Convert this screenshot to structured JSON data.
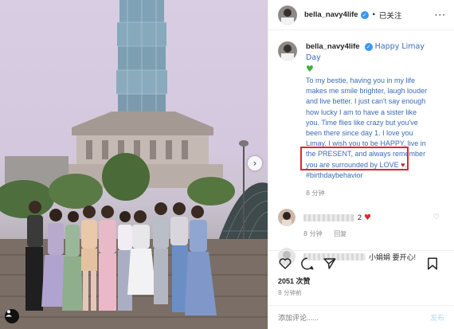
{
  "header": {
    "username": "bella_navy4life",
    "follow_status": "已关注",
    "separator": "•",
    "more_label": "···"
  },
  "caption": {
    "username": "bella_navy4life",
    "title": "Happy Limay Day",
    "lines": [
      "To my bestie, having you in my life",
      "makes me smile brighter, laugh louder",
      "and live better. I just can't say enough",
      "how lucky I am to have a sister like",
      "you. Time flies like crazy but you've",
      "been there since day 1. I love you",
      "Limay. I wish you to be HAPPY, live in",
      "the PRESENT, and always remember",
      "you are surrounded by LOVE",
      "#birthdaybehavior"
    ],
    "time": "8 分钟"
  },
  "comments": [
    {
      "text": "2",
      "time": "8 分钟",
      "reply_label": "回复"
    },
    {
      "text": "小娟娟 要开心!"
    }
  ],
  "likes": "2051 次赞",
  "posted": "8 分钟前",
  "add_comment": {
    "placeholder": "添加评论......",
    "post_label": "发布"
  },
  "icons": [
    "heart-icon",
    "comment-icon",
    "share-icon",
    "bookmark-icon",
    "tag-icon",
    "chevron-right-icon",
    "verified-icon"
  ],
  "colors": {
    "link": "#3b6cb5",
    "highlight_box": "#e0262f",
    "verified": "#3897f0",
    "post_button": "#b3dbff"
  }
}
